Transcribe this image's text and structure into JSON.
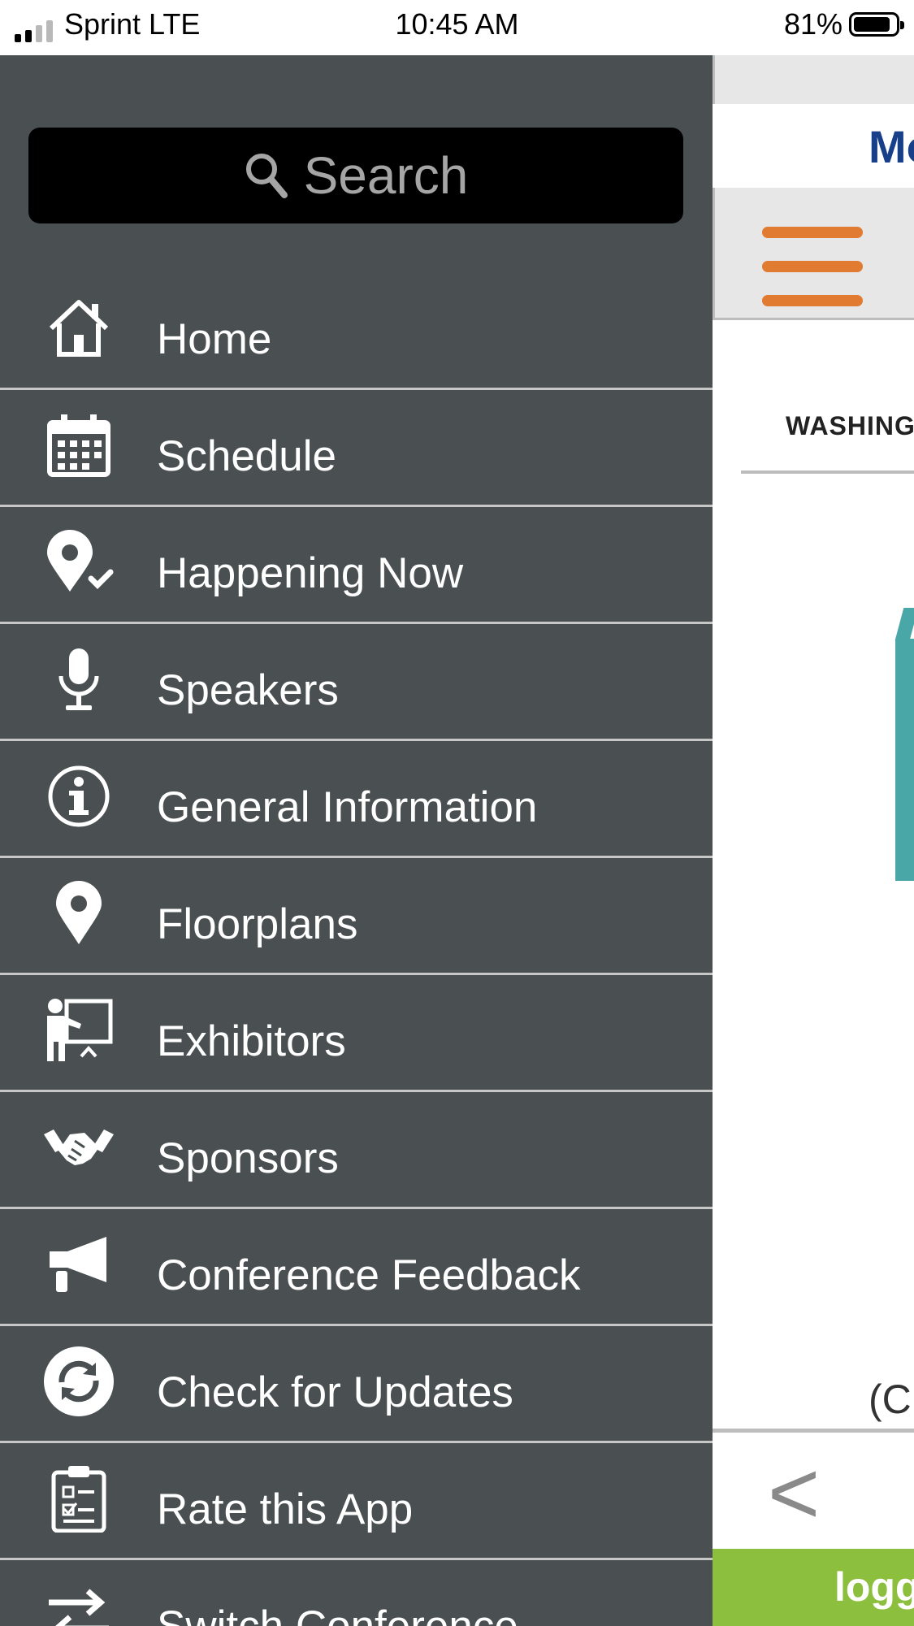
{
  "status_bar": {
    "carrier": "Sprint LTE",
    "time": "10:45 AM",
    "battery": "81%"
  },
  "drawer": {
    "search_placeholder": "Search",
    "items": [
      {
        "label": "Home",
        "icon": "home-icon"
      },
      {
        "label": "Schedule",
        "icon": "calendar-icon"
      },
      {
        "label": "Happening Now",
        "icon": "location-check-icon"
      },
      {
        "label": "Speakers",
        "icon": "microphone-icon"
      },
      {
        "label": "General Information",
        "icon": "info-icon"
      },
      {
        "label": "Floorplans",
        "icon": "map-pin-icon"
      },
      {
        "label": "Exhibitors",
        "icon": "presenter-board-icon"
      },
      {
        "label": "Sponsors",
        "icon": "handshake-icon"
      },
      {
        "label": "Conference Feedback",
        "icon": "megaphone-icon"
      },
      {
        "label": "Check for Updates",
        "icon": "refresh-icon"
      },
      {
        "label": "Rate this App",
        "icon": "clipboard-checklist-icon"
      },
      {
        "label": "Switch Conference",
        "icon": "swap-arrows-icon"
      }
    ]
  },
  "background_app": {
    "title_fragment": "Mo",
    "heading_fragment": "WASHING",
    "paren_fragment": "(C",
    "back_glyph": "<",
    "footer_fragment": "logg"
  },
  "colors": {
    "drawer_bg": "#4a5052",
    "accent_orange": "#e07b31",
    "title_blue": "#173f8a",
    "footer_green": "#8dbf3f"
  }
}
